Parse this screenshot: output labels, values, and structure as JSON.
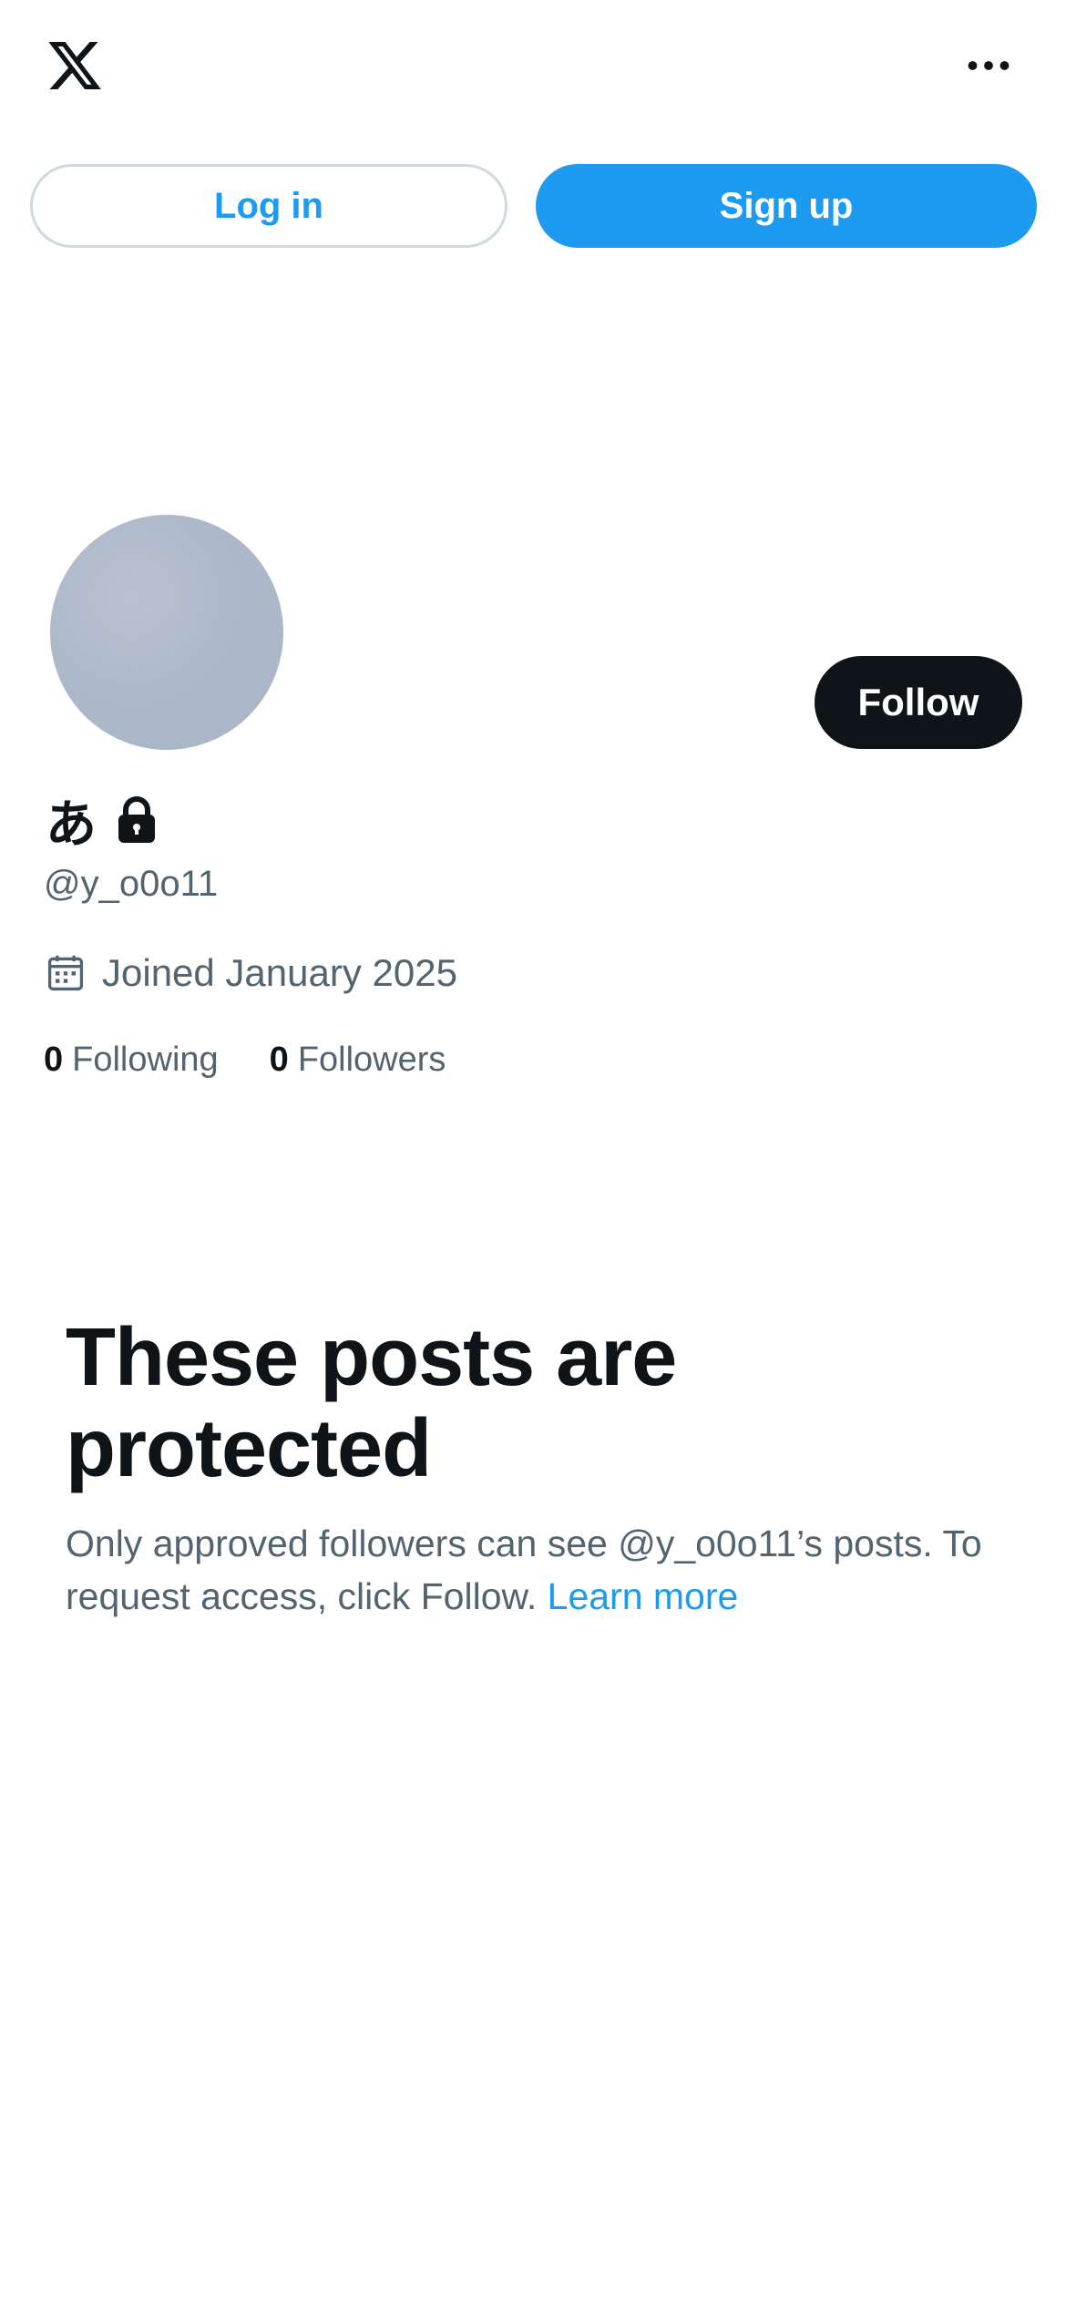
{
  "header": {
    "logo_icon": "x-logo-icon",
    "more_icon": "more-horizontal-icon"
  },
  "auth": {
    "login_label": "Log in",
    "signup_label": "Sign up"
  },
  "profile": {
    "display_name": "あ",
    "protected_icon": "lock-icon",
    "handle": "@y_o0o11",
    "joined_icon": "calendar-icon",
    "joined": "Joined January 2025",
    "follow_label": "Follow",
    "following_count": "0",
    "following_label": "Following",
    "followers_count": "0",
    "followers_label": "Followers"
  },
  "protected_notice": {
    "title": "These posts are protected",
    "description": "Only approved followers can see @y_o0o11’s posts. To request access, click Follow. ",
    "learn_more_label": "Learn more"
  },
  "colors": {
    "brand_blue": "#1d9bf0",
    "text_primary": "#0f1419",
    "text_secondary": "#536471",
    "border": "#cfd9de"
  }
}
